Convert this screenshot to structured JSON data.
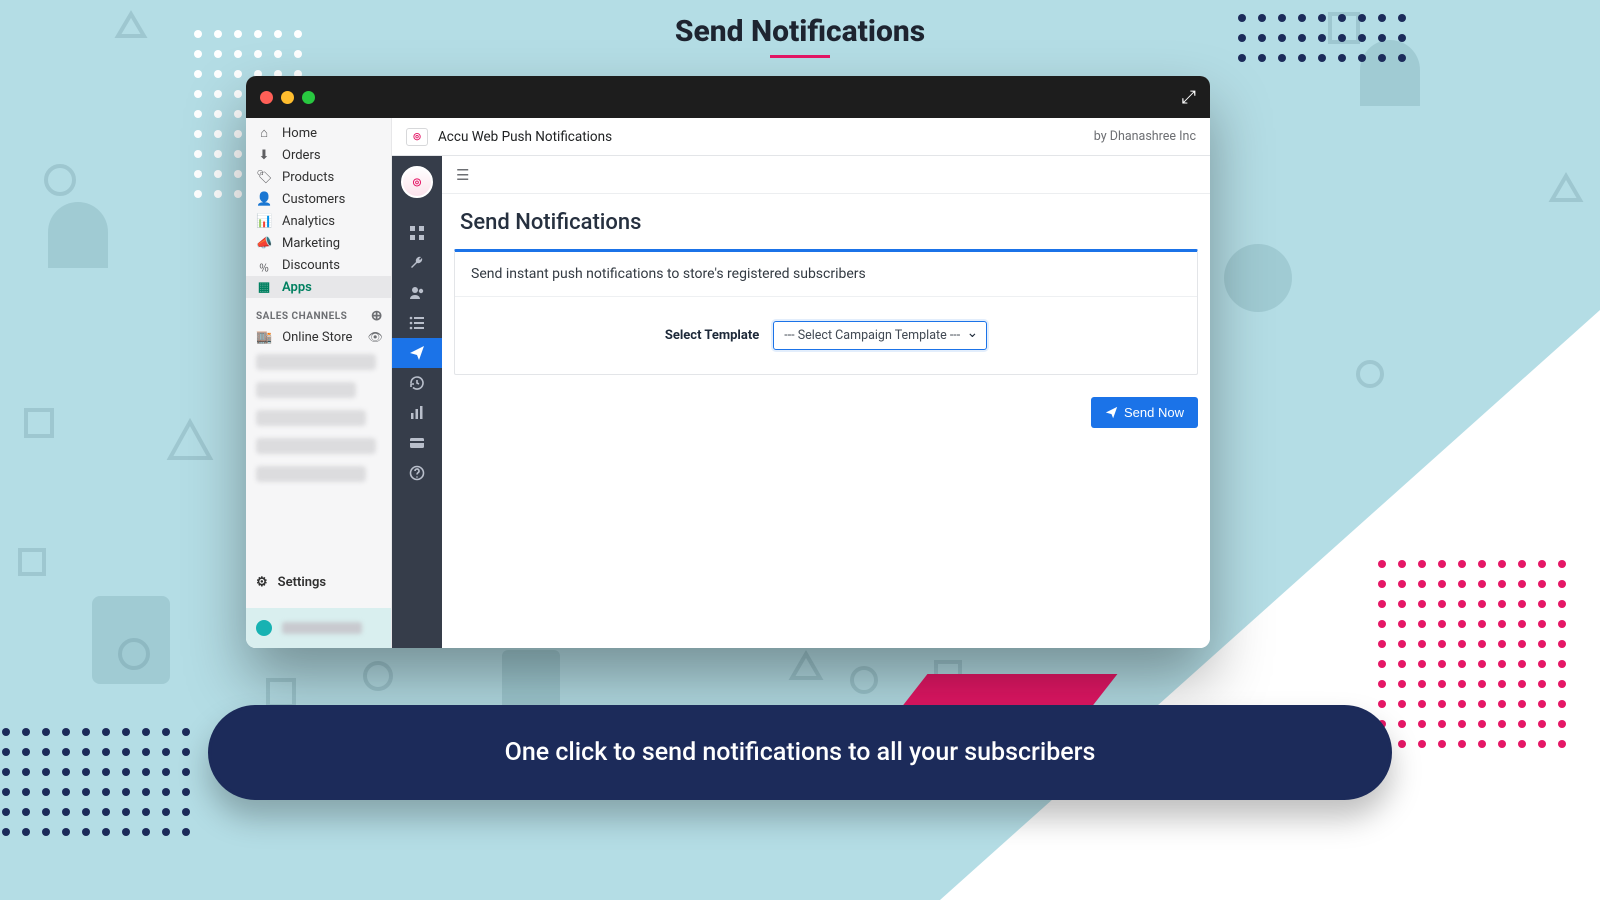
{
  "heading": "Send Notifications",
  "caption": "One click to send notifications to all your subscribers",
  "app": {
    "title": "Accu Web Push Notifications",
    "by": "by Dhanashree Inc"
  },
  "nav": {
    "home": "Home",
    "orders": "Orders",
    "products": "Products",
    "customers": "Customers",
    "analytics": "Analytics",
    "marketing": "Marketing",
    "discounts": "Discounts",
    "apps": "Apps",
    "section": "SALES CHANNELS",
    "online": "Online Store",
    "settings": "Settings"
  },
  "main": {
    "title": "Send Notifications",
    "desc": "Send instant push notifications to store's registered subscribers",
    "select_label": "Select Template",
    "select_placeholder": "--- Select Campaign Template ---",
    "send_label": "Send Now"
  }
}
